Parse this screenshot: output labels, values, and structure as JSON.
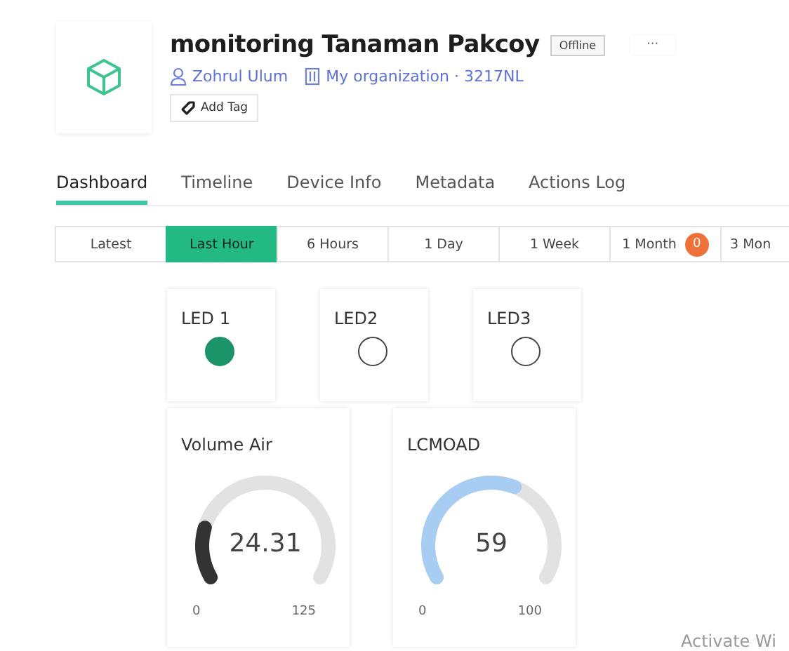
{
  "device": {
    "title": "monitoring Tanaman Pakcoy",
    "status": "Offline",
    "owner": "Zohrul Ulum",
    "organization": "My organization · 3217NL",
    "add_tag": "Add Tag",
    "more": "···"
  },
  "tabs": [
    {
      "label": "Dashboard",
      "selected": true
    },
    {
      "label": "Timeline",
      "selected": false
    },
    {
      "label": "Device Info",
      "selected": false
    },
    {
      "label": "Metadata",
      "selected": false
    },
    {
      "label": "Actions Log",
      "selected": false
    }
  ],
  "time_ranges": [
    {
      "label": "Latest",
      "selected": false
    },
    {
      "label": "Last Hour",
      "selected": true
    },
    {
      "label": "6 Hours",
      "selected": false
    },
    {
      "label": "1 Day",
      "selected": false
    },
    {
      "label": "1 Week",
      "selected": false
    },
    {
      "label": "1 Month",
      "selected": false,
      "badge": "0"
    },
    {
      "label": "3 Mon",
      "selected": false
    }
  ],
  "leds": [
    {
      "label": "LED 1",
      "on": true
    },
    {
      "label": "LED2",
      "on": false
    },
    {
      "label": "LED3",
      "on": false
    }
  ],
  "gauges": [
    {
      "label": "Volume Air",
      "value": "24.31",
      "min": "0",
      "max": "125",
      "color": "#333333"
    },
    {
      "label": "LCMOAD",
      "value": "59",
      "min": "0",
      "max": "100",
      "color": "#a8cdf2"
    }
  ],
  "os_notice": "Activate Wi"
}
